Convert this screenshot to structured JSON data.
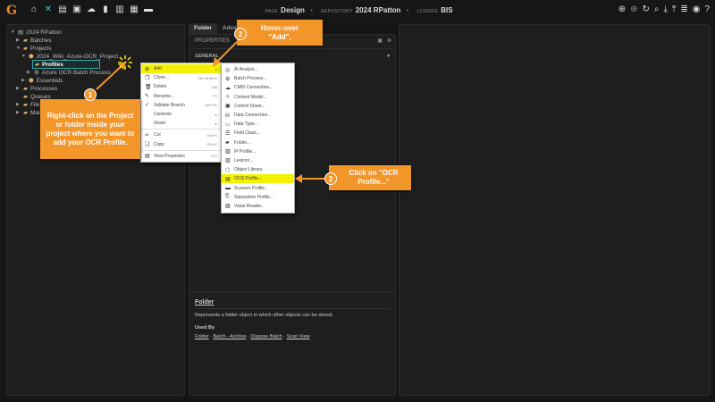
{
  "topbar": {
    "logo": "G",
    "page_label": "PAGE",
    "page": "Design",
    "repo_label": "REPOSITORY",
    "repo": "2024 RPatton",
    "license_label": "LICENSE",
    "license": "BIS"
  },
  "tree": {
    "root": "2024 RPatton",
    "items": [
      "Batches",
      "Projects",
      "2024_Wiki_Azure-OCR_Project",
      "Profiles",
      "Azure OCR Batch Process",
      "Essentials",
      "Processes",
      "Queues",
      "File",
      "Mac"
    ]
  },
  "tabs": [
    "Folder",
    "Advanced"
  ],
  "properties": {
    "title": "PROPERTIES",
    "general": "GENERAL"
  },
  "context_menu": [
    {
      "label": "Add",
      "shortcut": "",
      "icon": "⊕"
    },
    {
      "label": "Clone...",
      "shortcut": "Ctrl+Shift+D",
      "icon": "❐"
    },
    {
      "label": "Delete",
      "shortcut": "Del",
      "icon": "🗑"
    },
    {
      "label": "Rename...",
      "shortcut": "F2",
      "icon": "✎"
    },
    {
      "label": "Validate Branch",
      "shortcut": "Alt+F11",
      "icon": "✓"
    },
    {
      "label": "Contents",
      "shortcut": "",
      "icon": ""
    },
    {
      "label": "Share",
      "shortcut": "",
      "icon": ""
    },
    {
      "label": "Cut",
      "shortcut": "Ctrl+X",
      "icon": "✂"
    },
    {
      "label": "Copy",
      "shortcut": "Ctrl+C",
      "icon": "❏"
    },
    {
      "label": "View Properties",
      "shortcut": "F12",
      "icon": "▤"
    }
  ],
  "submenu": [
    "AI Analyst...",
    "Batch Process...",
    "CMIS Connection...",
    "Content Model...",
    "Control Sheet...",
    "Data Connection...",
    "Data Type...",
    "Field Class...",
    "Folder...",
    "IP Profile...",
    "Lexicon...",
    "Object Library...",
    "OCR Profile...",
    "Scanner Profile...",
    "Separation Profile...",
    "Value Reader..."
  ],
  "help": {
    "title": "Folder",
    "desc": "Represents a folder object in which other objects can be stored.",
    "used_by": "Used By",
    "links": [
      "Folder",
      "Batch - Archive",
      "Dispose Batch",
      "Scan View"
    ]
  },
  "callouts": [
    {
      "num": "1",
      "text": "Right-click on the Project or folder inside your project where you want to add your OCR Profile."
    },
    {
      "num": "2",
      "text": "Hover-over \"Add\"."
    },
    {
      "num": "3",
      "text": "Click on \"OCR Profile...\""
    }
  ],
  "colors": {
    "accent": "#f3962a",
    "highlight": "#f3f000"
  }
}
